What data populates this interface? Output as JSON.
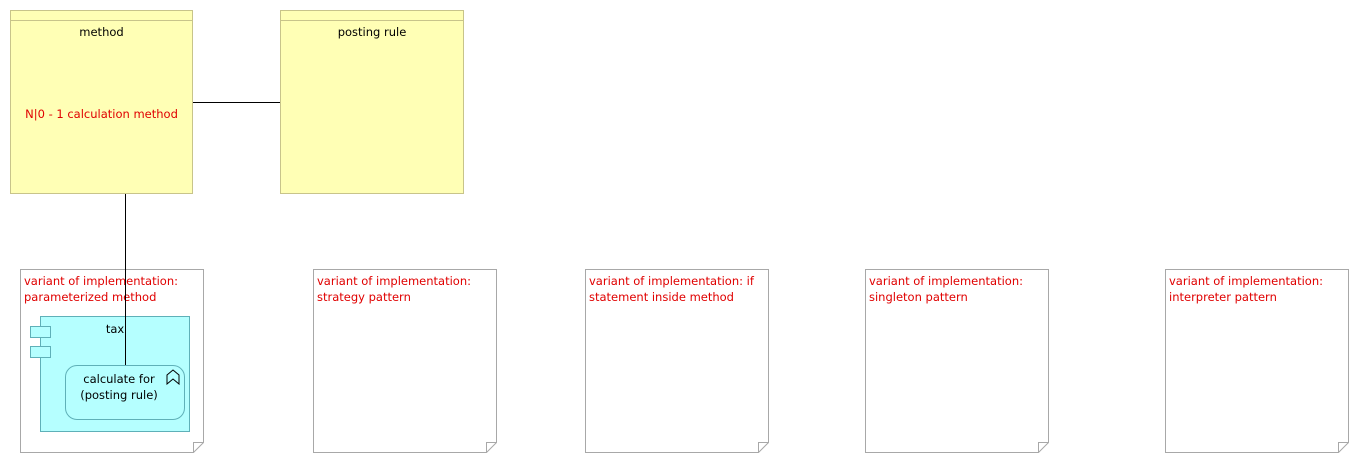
{
  "method_box": {
    "title": "method",
    "attribute": "N|0 - 1 calculation method"
  },
  "posting_rule_box": {
    "title": "posting rule"
  },
  "notes": [
    {
      "line1": "variant of implementation:",
      "line2": "parameterized method"
    },
    {
      "line1": "variant of implementation:",
      "line2": "strategy pattern"
    },
    {
      "line1": "variant of implementation: if",
      "line2": "statement inside method"
    },
    {
      "line1": "variant of implementation:",
      "line2": "singleton pattern"
    },
    {
      "line1": "variant of implementation:",
      "line2": "interpreter pattern"
    }
  ],
  "component": {
    "title": "tax",
    "function": {
      "line1": "calculate for",
      "line2": "(posting rule)"
    }
  },
  "colors": {
    "class_fill": "#ffffb5",
    "component_fill": "#b5ffff",
    "note_text": "#e00000"
  }
}
